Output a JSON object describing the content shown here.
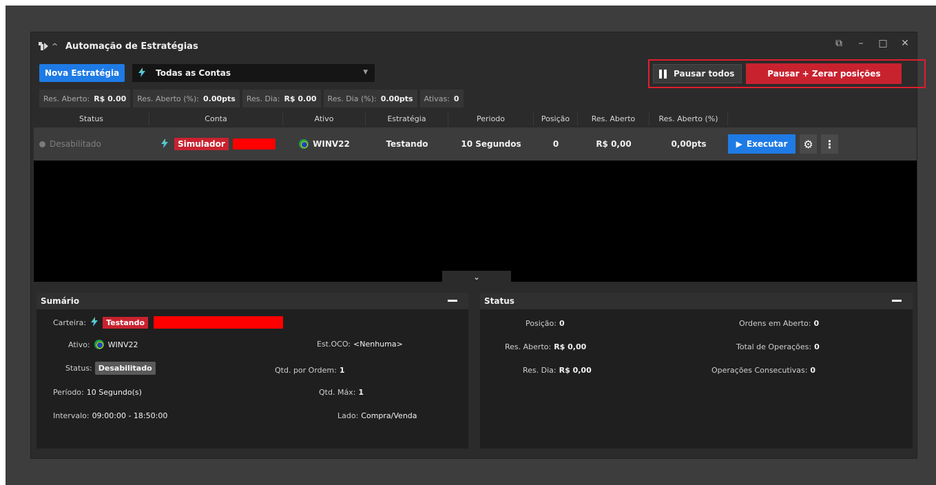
{
  "window": {
    "title": "Automação de Estratégias",
    "controls": {
      "popout": "⧉",
      "minimize": "–",
      "maximize": "□",
      "close": "✕"
    }
  },
  "toolbar": {
    "new_strategy_label": "Nova Estratégia",
    "account_selector_value": "Todas as Contas",
    "pause_all_label": "Pausar todos",
    "pause_zero_label": "Pausar + Zerar posições"
  },
  "metrics": [
    {
      "label": "Res. Aberto:",
      "value": "R$ 0.00"
    },
    {
      "label": "Res. Aberto (%):",
      "value": "0.00pts"
    },
    {
      "label": "Res. Dia:",
      "value": "R$ 0.00"
    },
    {
      "label": "Res. Dia (%):",
      "value": "0.00pts"
    },
    {
      "label": "Ativas:",
      "value": "0"
    }
  ],
  "table": {
    "columns": [
      "Status",
      "Conta",
      "Ativo",
      "Estratégia",
      "Periodo",
      "Posição",
      "Res. Aberto",
      "Res. Aberto (%)"
    ],
    "rows": [
      {
        "status": "Desabilitado",
        "conta": "Simulador",
        "ativo": "WINV22",
        "estrategia": "Testando",
        "periodo": "10 Segundos",
        "posicao": "0",
        "res_aberto": "R$ 0,00",
        "res_aberto_pct": "0,00pts",
        "execute_label": "Executar"
      }
    ]
  },
  "summary": {
    "title": "Sumário",
    "carteira_label": "Carteira:",
    "carteira_value": "Testando",
    "ativo_label": "Ativo:",
    "ativo_value": "WINV22",
    "status_label": "Status:",
    "status_value": "Desabilitado",
    "periodo_label": "Período:",
    "periodo_value": "10 Segundo(s)",
    "intervalo_label": "Intervalo:",
    "intervalo_value": "09:00:00 - 18:50:00",
    "oco_label": "Est.OCO:",
    "oco_value": "<Nenhuma>",
    "qtd_ordem_label": "Qtd. por Ordem:",
    "qtd_ordem_value": "1",
    "qtd_max_label": "Qtd. Máx:",
    "qtd_max_value": "1",
    "lado_label": "Lado:",
    "lado_value": "Compra/Venda"
  },
  "status_panel": {
    "title": "Status",
    "posicao_label": "Posição:",
    "posicao_value": "0",
    "res_aberto_label": "Res. Aberto:",
    "res_aberto_value": "R$ 0,00",
    "res_dia_label": "Res. Dia:",
    "res_dia_value": "R$ 0,00",
    "ordens_label": "Ordens em Aberto:",
    "ordens_value": "0",
    "total_label": "Total de Operações:",
    "total_value": "0",
    "consec_label": "Operações Consecutivas:",
    "consec_value": "0"
  },
  "colors": {
    "accent_blue": "#1e7be6",
    "danger_red": "#c9222f",
    "highlight_border": "#e01e2d"
  }
}
